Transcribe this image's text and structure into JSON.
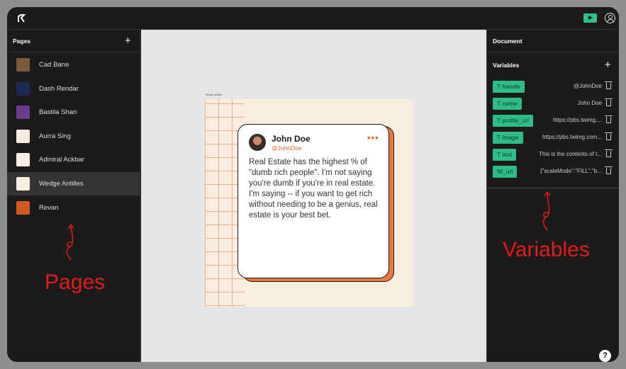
{
  "topbar": {
    "logo": "logo-r-icon",
    "play_icon": "play-icon",
    "account_icon": "user-circle-icon"
  },
  "pages_panel": {
    "title": "Pages",
    "add_icon": "+",
    "items": [
      {
        "label": "Cad Bane",
        "thumb_color": "#7a5a3a"
      },
      {
        "label": "Dash Rendar",
        "thumb_color": "#1d2a55"
      },
      {
        "label": "Bastila Shan",
        "thumb_color": "#6b3c8f"
      },
      {
        "label": "Aurra Sing",
        "thumb_color": "#f5ece0"
      },
      {
        "label": "Admiral Ackbar",
        "thumb_color": "#f6ede4"
      },
      {
        "label": "Wedge Antilles",
        "thumb_color": "#f7eedd"
      },
      {
        "label": "Revan",
        "thumb_color": "#d2591c"
      }
    ],
    "active_index": 5
  },
  "canvas": {
    "frame_label": "Wedge Antilles",
    "tweet": {
      "name": "John Doe",
      "handle": "@JohnDoe",
      "menu": "•••",
      "text": "Real Estate has the highest % of \"dumb rich people\". I'm not saying you're dumb if you're in real estate. I'm saying -- if you want to get rich without needing to be a genius, real estate is your best bet."
    }
  },
  "document_panel": {
    "title": "Document",
    "variables_title": "Variables",
    "add_icon": "+",
    "variables": [
      {
        "name": "T handle",
        "value": "@JohnDoe"
      },
      {
        "name": "T name",
        "value": "John Doe"
      },
      {
        "name": "T profile_url",
        "value": "https://pbs.twimg...."
      },
      {
        "name": "T image",
        "value": "https://pbs.twimg.com..."
      },
      {
        "name": "T text",
        "value": "This is the contents of t..."
      },
      {
        "name": "fill_url",
        "value": "{\"scaleMode\":\"FILL\",\"b..."
      }
    ]
  },
  "annotations": {
    "pages": "Pages",
    "variables": "Variables"
  },
  "help_label": "?",
  "colors": {
    "accent": "#2dbd87",
    "annotation": "#e01b1b",
    "card_shadow": "#e7773a"
  }
}
